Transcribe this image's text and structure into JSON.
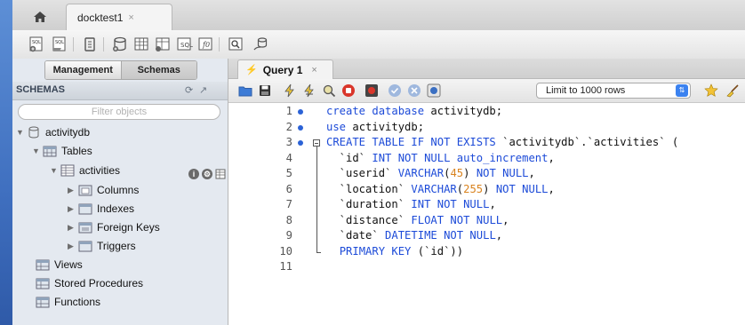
{
  "app": {
    "connection_tab": "docktest1",
    "close_glyph": "×"
  },
  "left_panel": {
    "segments": [
      "Management",
      "Schemas"
    ],
    "schemas_header": "SCHEMAS",
    "filter_placeholder": "Filter objects",
    "tree": {
      "schema": "activitydb",
      "tables_label": "Tables",
      "table": "activities",
      "table_children": [
        "Columns",
        "Indexes",
        "Foreign Keys",
        "Triggers"
      ],
      "others": [
        "Views",
        "Stored Procedures",
        "Functions"
      ]
    }
  },
  "query": {
    "tab_label": "Query 1",
    "limit_value": "Limit to 1000 rows",
    "lines": [
      [
        [
          "kw",
          "create database"
        ],
        [
          "t",
          " activitydb;"
        ]
      ],
      [
        [
          "kw",
          "use"
        ],
        [
          "t",
          " activitydb;"
        ]
      ],
      [
        [
          "kw",
          "CREATE TABLE IF NOT EXISTS"
        ],
        [
          "t",
          " `activitydb`.`activities` ("
        ]
      ],
      [
        [
          "t",
          "  `id` "
        ],
        [
          "kw",
          "INT NOT NULL auto_increment"
        ],
        [
          "t",
          ","
        ]
      ],
      [
        [
          "t",
          "  `userid` "
        ],
        [
          "kw",
          "VARCHAR"
        ],
        [
          "t",
          "("
        ],
        [
          "num",
          "45"
        ],
        [
          "t",
          ") "
        ],
        [
          "kw",
          "NOT NULL"
        ],
        [
          "t",
          ","
        ]
      ],
      [
        [
          "t",
          "  `location` "
        ],
        [
          "kw",
          "VARCHAR"
        ],
        [
          "t",
          "("
        ],
        [
          "num",
          "255"
        ],
        [
          "t",
          ") "
        ],
        [
          "kw",
          "NOT NULL"
        ],
        [
          "t",
          ","
        ]
      ],
      [
        [
          "t",
          "  `duration` "
        ],
        [
          "kw",
          "INT NOT NULL"
        ],
        [
          "t",
          ","
        ]
      ],
      [
        [
          "t",
          "  `distance` "
        ],
        [
          "kw",
          "FLOAT NOT NULL"
        ],
        [
          "t",
          ","
        ]
      ],
      [
        [
          "t",
          "  `date` "
        ],
        [
          "kw",
          "DATETIME NOT NULL"
        ],
        [
          "t",
          ","
        ]
      ],
      [
        [
          "t",
          "  "
        ],
        [
          "kw",
          "PRIMARY KEY"
        ],
        [
          "t",
          " (`id`))"
        ]
      ],
      []
    ],
    "line_numbers": [
      "1",
      "2",
      "3",
      "4",
      "5",
      "6",
      "7",
      "8",
      "9",
      "10",
      "11"
    ],
    "executed_lines": [
      1,
      2,
      3
    ]
  },
  "colors": {
    "keyword": "#1d4bd8",
    "number": "#d9831f",
    "marker": "#2b62d6"
  }
}
